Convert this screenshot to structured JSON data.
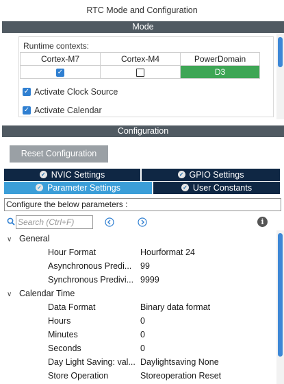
{
  "window": {
    "title": "RTC Mode and Configuration"
  },
  "mode": {
    "header": "Mode",
    "runtime_label": "Runtime contexts:",
    "columns": [
      "Cortex-M7",
      "Cortex-M4",
      "PowerDomain"
    ],
    "values": {
      "m7_checked": true,
      "m4_checked": false,
      "power_domain": "D3"
    },
    "checkboxes": [
      {
        "label": "Activate Clock Source",
        "checked": true
      },
      {
        "label": "Activate Calendar",
        "checked": true
      }
    ]
  },
  "config": {
    "header": "Configuration",
    "reset_label": "Reset Configuration",
    "tabs": [
      {
        "label": "NVIC Settings",
        "icon": "check-circle-icon"
      },
      {
        "label": "GPIO Settings",
        "icon": "check-circle-icon"
      },
      {
        "label": "Parameter Settings",
        "icon": "check-circle-icon",
        "active": true
      },
      {
        "label": "User Constants",
        "icon": "check-circle-icon"
      }
    ],
    "description": "Configure the below parameters :",
    "search_placeholder": "Search (Ctrl+F)",
    "groups": [
      {
        "name": "General",
        "params": [
          {
            "name": "Hour Format",
            "value": "Hourformat 24"
          },
          {
            "name": "Asynchronous Predi...",
            "value": "99"
          },
          {
            "name": "Synchronous Predivi...",
            "value": "9999"
          }
        ]
      },
      {
        "name": "Calendar Time",
        "params": [
          {
            "name": "Data Format",
            "value": "Binary data format"
          },
          {
            "name": "Hours",
            "value": "0"
          },
          {
            "name": "Minutes",
            "value": "0"
          },
          {
            "name": "Seconds",
            "value": "0"
          },
          {
            "name": "Day Light Saving: val...",
            "value": "Daylightsaving None"
          },
          {
            "name": "Store Operation",
            "value": "Storeoperation Reset"
          }
        ]
      }
    ]
  },
  "colors": {
    "section_bar": "#505a62",
    "tab_dark": "#0f2744",
    "tab_active": "#3b9ed8",
    "power_domain": "#3ea655",
    "scroll_thumb": "#3d87d6"
  }
}
